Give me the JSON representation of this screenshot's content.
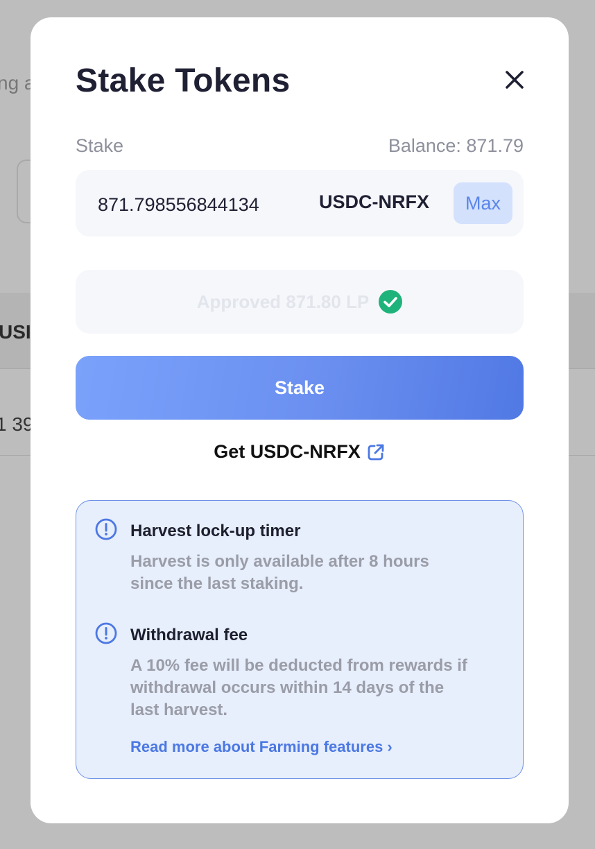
{
  "background": {
    "fragment_top": "ng a",
    "fragment_header": "USI",
    "fragment_row": "1 39"
  },
  "modal": {
    "title": "Stake Tokens",
    "stake_label": "Stake",
    "balance": "Balance: 871.79",
    "amount_value": "871.798556844134",
    "token": "USDC-NRFX",
    "max_label": "Max",
    "approved_text": "Approved 871.80 LP",
    "stake_button": "Stake",
    "get_link": "Get USDC-NRFX"
  },
  "info": {
    "items": [
      {
        "title": "Harvest lock-up timer",
        "description": "Harvest is only available after 8 hours since the last staking."
      },
      {
        "title": "Withdrawal fee",
        "description": "A 10% fee will be deducted from rewards if withdrawal occurs within 14 days of the last harvest."
      }
    ],
    "read_more": "Read more about Farming features ›"
  },
  "icons": {
    "close": "close-icon",
    "approved": "check-circle-icon",
    "external_link": "external-link-icon",
    "info": "info-circle-icon"
  },
  "colors": {
    "accent": "#5a85eb",
    "success": "#1eb37a",
    "info_border": "#6f91e6",
    "info_background": "#e7eefc"
  }
}
